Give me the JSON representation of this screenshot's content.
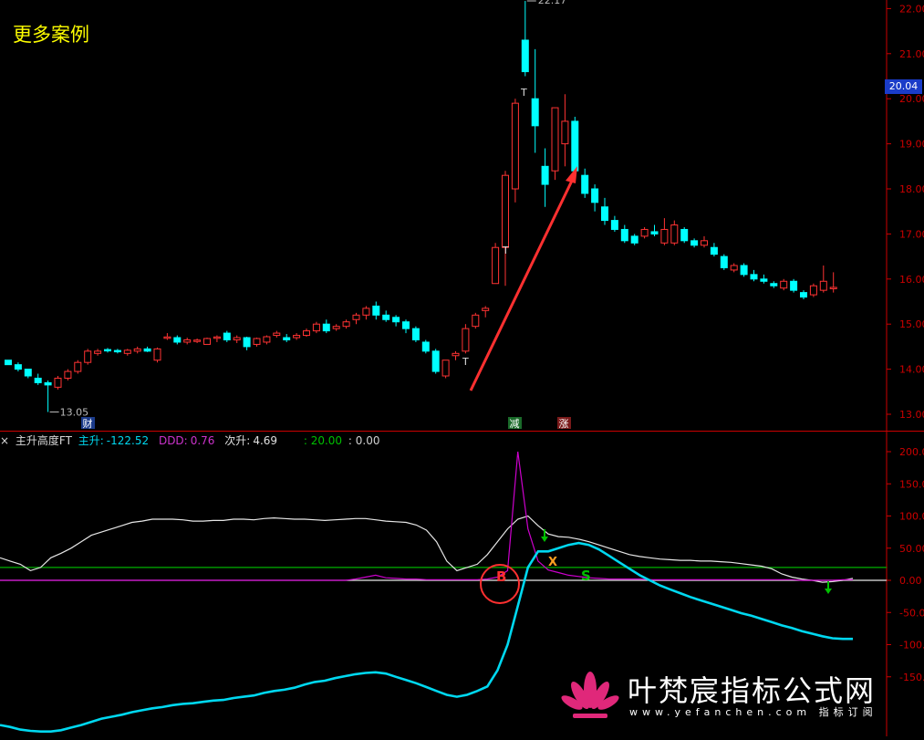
{
  "title": "更多案例",
  "price_axis": [
    "22.00",
    "21.00",
    "20.00",
    "19.00",
    "18.00",
    "17.00",
    "16.00",
    "15.00",
    "14.00",
    "13.00"
  ],
  "price_badge": "20.04",
  "ind_axis": [
    "200.0",
    "150.0",
    "100.0",
    "50.00",
    "0.00",
    "-50.00",
    "-100.0",
    "-150.0"
  ],
  "indicator": {
    "name": "主升高度FT",
    "zs_label": "主升:",
    "zs_value": "-122.52",
    "ddd_label": "DDD:",
    "ddd_value": "0.76",
    "cs_label": "次升:",
    "cs_value": "4.69",
    "line20": ": 20.00",
    "line0": ": 0.00"
  },
  "annotations": {
    "high": "22.17",
    "low": "13.05",
    "event_cai": "财",
    "event_jian": "减",
    "event_zhang": "涨",
    "sig_B": "B",
    "sig_S": "S",
    "sig_X": "X"
  },
  "watermark": {
    "text": "叶梵宸指标公式网",
    "url": "www.yefanchen.com 指标订阅"
  },
  "colors": {
    "up": "#ff3333",
    "down": "#00ffff",
    "axis": "#cc0000",
    "white_line": "#e6e6e6",
    "purple": "#cc00cc",
    "cyan": "#00d8f0",
    "green": "#00b000"
  },
  "chart_data": [
    {
      "type": "candlestick",
      "ylim": [
        12.8,
        22.2
      ],
      "ohlc": [
        [
          14.2,
          14.2,
          14.1,
          14.1
        ],
        [
          14.1,
          14.15,
          13.95,
          14.0
        ],
        [
          14.0,
          14.0,
          13.8,
          13.85
        ],
        [
          13.8,
          13.9,
          13.65,
          13.7
        ],
        [
          13.7,
          13.75,
          13.05,
          13.65
        ],
        [
          13.6,
          13.85,
          13.55,
          13.8
        ],
        [
          13.8,
          14.0,
          13.75,
          13.95
        ],
        [
          13.95,
          14.2,
          13.9,
          14.15
        ],
        [
          14.15,
          14.45,
          14.1,
          14.4
        ],
        [
          14.35,
          14.45,
          14.3,
          14.4
        ],
        [
          14.42,
          14.47,
          14.37,
          14.4
        ],
        [
          14.4,
          14.45,
          14.35,
          14.38
        ],
        [
          14.35,
          14.45,
          14.3,
          14.42
        ],
        [
          14.4,
          14.5,
          14.35,
          14.45
        ],
        [
          14.45,
          14.5,
          14.38,
          14.4
        ],
        [
          14.2,
          14.48,
          14.15,
          14.45
        ],
        [
          14.7,
          14.8,
          14.65,
          14.7
        ],
        [
          14.7,
          14.75,
          14.55,
          14.6
        ],
        [
          14.6,
          14.7,
          14.55,
          14.65
        ],
        [
          14.62,
          14.68,
          14.58,
          14.63
        ],
        [
          14.55,
          14.7,
          14.55,
          14.68
        ],
        [
          14.68,
          14.75,
          14.6,
          14.7
        ],
        [
          14.8,
          14.85,
          14.6,
          14.65
        ],
        [
          14.65,
          14.75,
          14.58,
          14.7
        ],
        [
          14.7,
          14.72,
          14.42,
          14.5
        ],
        [
          14.55,
          14.7,
          14.5,
          14.68
        ],
        [
          14.6,
          14.75,
          14.55,
          14.72
        ],
        [
          14.75,
          14.85,
          14.7,
          14.8
        ],
        [
          14.7,
          14.78,
          14.6,
          14.65
        ],
        [
          14.7,
          14.8,
          14.65,
          14.75
        ],
        [
          14.75,
          14.9,
          14.72,
          14.85
        ],
        [
          14.85,
          15.05,
          14.8,
          15.0
        ],
        [
          15.0,
          15.1,
          14.8,
          14.85
        ],
        [
          14.9,
          15.0,
          14.85,
          14.95
        ],
        [
          14.95,
          15.1,
          14.9,
          15.05
        ],
        [
          15.1,
          15.25,
          15.0,
          15.2
        ],
        [
          15.2,
          15.4,
          15.1,
          15.35
        ],
        [
          15.4,
          15.5,
          15.1,
          15.2
        ],
        [
          15.2,
          15.3,
          15.05,
          15.1
        ],
        [
          15.15,
          15.2,
          14.95,
          15.05
        ],
        [
          15.05,
          15.1,
          14.8,
          14.9
        ],
        [
          14.9,
          14.95,
          14.6,
          14.65
        ],
        [
          14.6,
          14.65,
          14.35,
          14.4
        ],
        [
          14.4,
          14.45,
          13.9,
          13.95
        ],
        [
          13.85,
          14.2,
          13.8,
          14.2
        ],
        [
          14.3,
          14.4,
          14.2,
          14.35
        ],
        [
          14.4,
          15.0,
          14.35,
          14.9
        ],
        [
          14.95,
          15.25,
          14.9,
          15.2
        ],
        [
          15.3,
          15.4,
          15.15,
          15.35
        ],
        [
          15.9,
          16.8,
          15.9,
          16.7
        ],
        [
          16.7,
          18.4,
          15.85,
          18.3
        ],
        [
          18.0,
          20.0,
          17.7,
          19.9
        ],
        [
          21.3,
          22.17,
          20.5,
          20.6
        ],
        [
          20.0,
          21.1,
          18.8,
          19.4
        ],
        [
          18.5,
          18.9,
          17.6,
          18.1
        ],
        [
          18.4,
          19.8,
          18.2,
          19.8
        ],
        [
          19.0,
          20.1,
          18.5,
          19.5
        ],
        [
          19.5,
          19.6,
          18.3,
          18.4
        ],
        [
          18.3,
          18.45,
          17.8,
          17.9
        ],
        [
          18.0,
          18.1,
          17.5,
          17.7
        ],
        [
          17.6,
          17.8,
          17.2,
          17.3
        ],
        [
          17.3,
          17.4,
          17.05,
          17.1
        ],
        [
          17.1,
          17.2,
          16.8,
          16.85
        ],
        [
          16.95,
          17.0,
          16.75,
          16.8
        ],
        [
          16.95,
          17.15,
          16.9,
          17.1
        ],
        [
          17.05,
          17.2,
          16.95,
          17.0
        ],
        [
          16.8,
          17.35,
          16.75,
          17.1
        ],
        [
          16.8,
          17.3,
          16.75,
          17.2
        ],
        [
          17.1,
          17.15,
          16.8,
          16.85
        ],
        [
          16.85,
          16.9,
          16.7,
          16.75
        ],
        [
          16.75,
          16.95,
          16.7,
          16.85
        ],
        [
          16.7,
          16.8,
          16.5,
          16.55
        ],
        [
          16.5,
          16.55,
          16.2,
          16.25
        ],
        [
          16.2,
          16.35,
          16.15,
          16.3
        ],
        [
          16.3,
          16.35,
          16.05,
          16.1
        ],
        [
          16.1,
          16.2,
          15.95,
          16.0
        ],
        [
          16.0,
          16.1,
          15.9,
          15.95
        ],
        [
          15.9,
          15.95,
          15.8,
          15.85
        ],
        [
          15.8,
          16.0,
          15.75,
          15.95
        ],
        [
          15.95,
          16.0,
          15.7,
          15.75
        ],
        [
          15.7,
          15.75,
          15.55,
          15.6
        ],
        [
          15.65,
          15.9,
          15.6,
          15.85
        ],
        [
          15.75,
          16.3,
          15.7,
          15.95
        ],
        [
          15.8,
          16.15,
          15.7,
          15.8
        ]
      ]
    },
    {
      "type": "line",
      "ylim": [
        -240,
        205
      ],
      "series": [
        {
          "name": "主升",
          "values": [
            -225,
            -228,
            -232,
            -234,
            -235,
            -235,
            -233,
            -229,
            -225,
            -220,
            -215,
            -212,
            -209,
            -205,
            -202,
            -199,
            -197,
            -194,
            -192,
            -191,
            -189,
            -187,
            -186,
            -183,
            -181,
            -179,
            -175,
            -172,
            -170,
            -167,
            -162,
            -158,
            -156,
            -152,
            -149,
            -146,
            -144,
            -143,
            -145,
            -150,
            -155,
            -160,
            -166,
            -172,
            -178,
            -181,
            -178,
            -172,
            -165,
            -140,
            -100,
            -40,
            20,
            45,
            45,
            50,
            55,
            58,
            55,
            48,
            38,
            28,
            18,
            8,
            0,
            -8,
            -14,
            -20,
            -26,
            -31,
            -36,
            -41,
            -46,
            -51,
            -55,
            -60,
            -65,
            -70,
            -74,
            -79,
            -83,
            -87,
            -90,
            -91,
            -91
          ]
        },
        {
          "name": "DDD",
          "values": [
            0,
            0,
            0,
            0,
            0,
            0,
            0,
            0,
            0,
            0,
            0,
            0,
            0,
            0,
            0,
            0,
            0,
            0,
            0,
            0,
            0,
            0,
            0,
            0,
            0,
            0,
            0,
            0,
            0,
            0,
            0,
            0,
            0,
            0,
            0,
            2,
            5,
            8,
            4,
            3,
            2,
            2,
            1,
            1,
            1,
            1,
            1,
            1,
            2,
            5,
            15,
            200,
            80,
            30,
            16,
            12,
            8,
            6,
            4,
            3,
            2,
            2,
            2,
            2,
            1,
            1,
            1,
            1,
            1,
            1,
            1,
            1,
            1,
            1,
            1,
            1,
            1,
            1,
            1,
            0,
            0,
            0,
            0,
            1,
            1
          ]
        },
        {
          "name": "次升",
          "values": [
            35,
            30,
            25,
            15,
            20,
            35,
            42,
            50,
            60,
            70,
            75,
            80,
            85,
            90,
            92,
            95,
            95,
            95,
            94,
            92,
            92,
            93,
            93,
            95,
            95,
            94,
            96,
            97,
            96,
            95,
            95,
            94,
            93,
            94,
            95,
            96,
            96,
            94,
            92,
            91,
            90,
            86,
            78,
            60,
            30,
            15,
            20,
            25,
            40,
            60,
            80,
            95,
            100,
            85,
            72,
            68,
            67,
            64,
            60,
            55,
            50,
            45,
            40,
            37,
            35,
            33,
            32,
            31,
            31,
            30,
            30,
            29,
            28,
            26,
            24,
            22,
            18,
            10,
            5,
            2,
            0,
            -3,
            -2,
            0,
            3
          ]
        },
        {
          "name": "20.00",
          "values": [
            20,
            20
          ]
        },
        {
          "name": "0.00",
          "values": [
            0,
            0
          ]
        }
      ]
    }
  ]
}
